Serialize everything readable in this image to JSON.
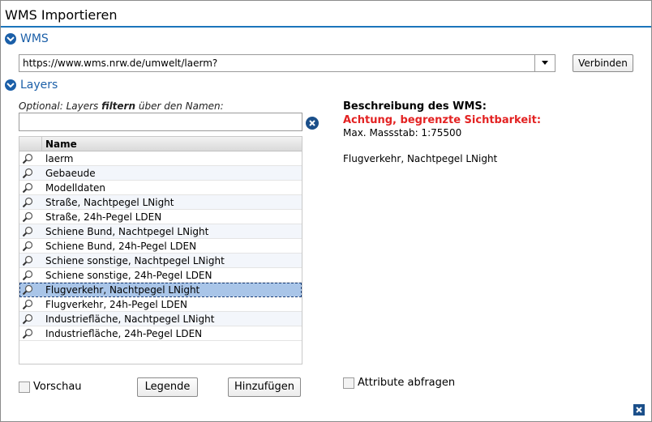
{
  "window": {
    "title": "WMS Importieren"
  },
  "wms_section": {
    "label": "WMS"
  },
  "url": {
    "value": "https://www.wms.nrw.de/umwelt/laerm?",
    "connect_label": "Verbinden"
  },
  "layers_section": {
    "label": "Layers"
  },
  "filter": {
    "label_pre": "Optional: Layers ",
    "label_bold": "filtern",
    "label_post": " über den Namen:",
    "value": ""
  },
  "grid": {
    "column_name": "Name",
    "rows": [
      "laerm",
      "Gebaeude",
      "Modelldaten",
      "Straße, Nachtpegel LNight",
      "Straße, 24h-Pegel LDEN",
      "Schiene Bund, Nachtpegel LNight",
      "Schiene Bund, 24h-Pegel LDEN",
      "Schiene sonstige, Nachtpegel LNight",
      "Schiene sonstige, 24h-Pegel LDEN",
      "Flugverkehr, Nachtpegel LNight",
      "Flugverkehr, 24h-Pegel LDEN",
      "Industriefläche, Nachtpegel LNight",
      "Industriefläche, 24h-Pegel LDEN"
    ],
    "selected_index": 9
  },
  "description": {
    "title": "Beschreibung des WMS:",
    "warning": "Achtung, begrenzte Sichtbarkeit:",
    "scale": "Max. Massstab: 1:75500",
    "layer": "Flugverkehr, Nachtpegel LNight"
  },
  "footer": {
    "preview_label": "Vorschau",
    "legend_label": "Legende",
    "add_label": "Hinzufügen",
    "attributes_label": "Attribute abfragen"
  },
  "colors": {
    "accent": "#1b75bb",
    "warning": "#e32222",
    "selected_row": "#a9c5e8"
  }
}
